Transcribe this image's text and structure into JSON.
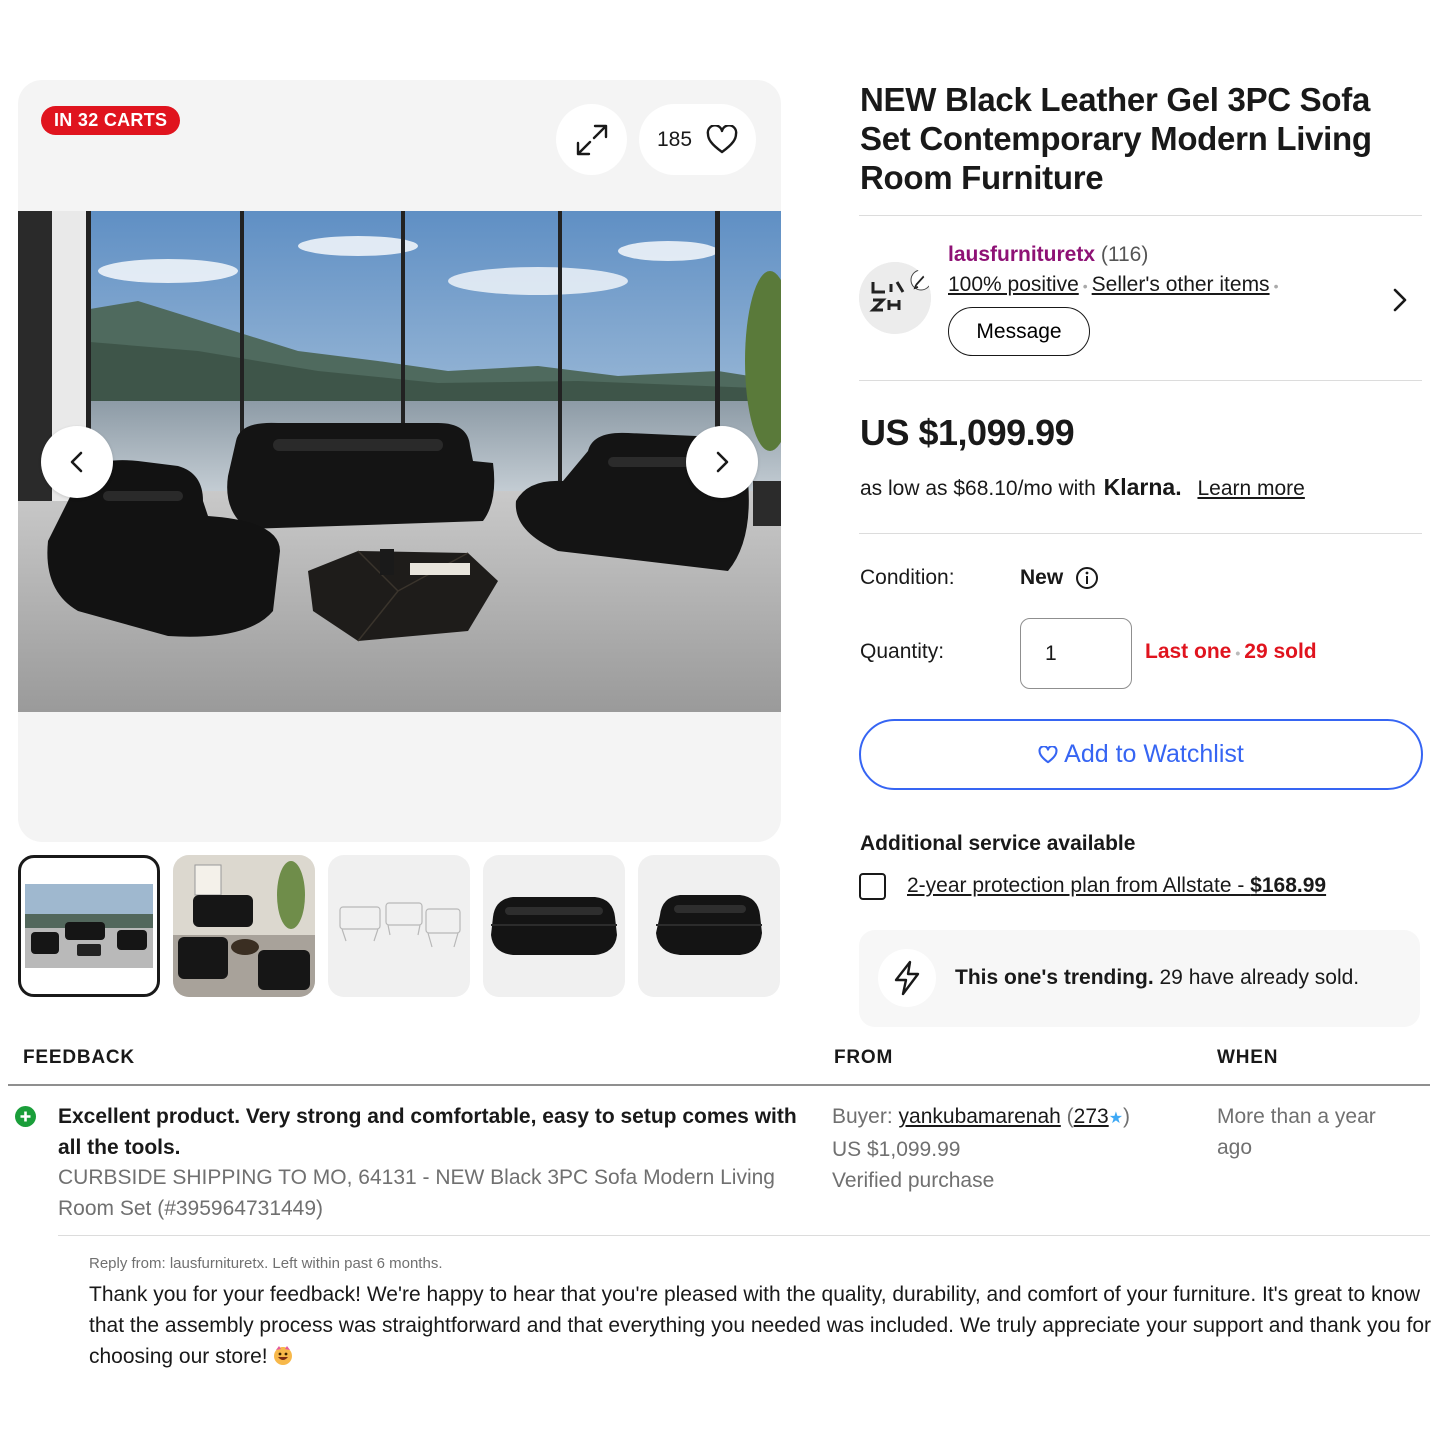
{
  "gallery": {
    "badge": "IN 32 CARTS",
    "watch_count": "185",
    "icons": {
      "expand": "expand-icon",
      "heart": "heart-icon",
      "prev": "chevron-left-icon",
      "next": "chevron-right-icon"
    },
    "thumbnail_count": 5
  },
  "product": {
    "title": "NEW Black Leather Gel 3PC Sofa Set Contemporary Modern Living Room Furniture"
  },
  "seller": {
    "name": "lausfurnituretx",
    "feedback_count": "(116)",
    "positive": "100% positive",
    "other_items": "Seller's other items",
    "message_label": "Message",
    "name_color": "#8e1175"
  },
  "pricing": {
    "price": "US $1,099.99",
    "klarna_prefix": "as low as $68.10/mo with",
    "klarna_logo": "Klarna.",
    "learn_more": "Learn more"
  },
  "condition": {
    "label": "Condition:",
    "value": "New"
  },
  "quantity": {
    "label": "Quantity:",
    "value": "1",
    "last_one": "Last one",
    "sold": "29 sold",
    "status_color": "#e0141e"
  },
  "watchlist": {
    "label": "Add to Watchlist",
    "accent": "#3665f3"
  },
  "additional_service": {
    "title": "Additional service available",
    "plan_text": "2-year protection plan from Allstate - ",
    "plan_price": "$168.99"
  },
  "trending": {
    "bold": "This one's trending.",
    "rest": " 29 have already sold."
  },
  "feedback": {
    "headers": {
      "feedback": "FEEDBACK",
      "from": "FROM",
      "when": "WHEN"
    },
    "entry": {
      "comment": "Excellent product. Very strong and comfortable, easy to setup comes with all the tools.",
      "item": "CURBSIDE SHIPPING TO MO, 64131 - NEW Black 3PC Sofa Modern Living Room Set (#395964731449)",
      "buyer_prefix": "Buyer: ",
      "buyer": "yankubamarenah",
      "buyer_score": "273",
      "price": "US $1,099.99",
      "verified": "Verified purchase",
      "when": "More than a year ago"
    },
    "reply": {
      "meta": "Reply from: lausfurnituretx. Left within past 6 months.",
      "text": "Thank you for your feedback! We're happy to hear that you're pleased with the quality, durability, and comfort of your furniture. It's great to know that the assembly process was straightforward and that everything you needed was included. We truly appreciate your support and thank you for choosing our store!"
    }
  }
}
